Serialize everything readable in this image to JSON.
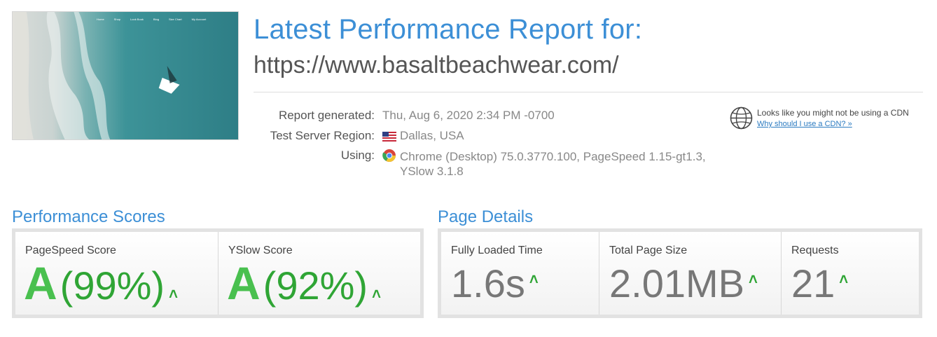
{
  "thumbnail": {
    "nav_items": [
      "Home",
      "Shop",
      "Look Book",
      "Blog",
      "Size Chart",
      "My Account"
    ]
  },
  "report": {
    "title": "Latest Performance Report for:",
    "url": "https://www.basaltbeachwear.com/"
  },
  "meta": {
    "generated_label": "Report generated:",
    "generated_value": "Thu, Aug 6, 2020 2:34 PM -0700",
    "region_label": "Test Server Region:",
    "region_value": "Dallas, USA",
    "using_label": "Using:",
    "using_value_line1": "Chrome (Desktop) 75.0.3770.100, PageSpeed 1.15-gt1.3,",
    "using_value_line2": "YSlow 3.1.8"
  },
  "cdn": {
    "text": "Looks like you might not be using a CDN",
    "link": "Why should I use a CDN? »"
  },
  "performance": {
    "title": "Performance Scores",
    "pagespeed": {
      "label": "PageSpeed Score",
      "grade": "A",
      "percent": "(99%)"
    },
    "yslow": {
      "label": "YSlow Score",
      "grade": "A",
      "percent": "(92%)"
    }
  },
  "details": {
    "title": "Page Details",
    "load_time": {
      "label": "Fully Loaded Time",
      "value": "1.6s"
    },
    "page_size": {
      "label": "Total Page Size",
      "value": "2.01MB"
    },
    "requests": {
      "label": "Requests",
      "value": "21"
    }
  },
  "colors": {
    "accent_blue": "#3c8fd6",
    "grade_green": "#49c04f",
    "arrow_green": "#2fa535"
  },
  "icons": {
    "up_arrow": "chevron-up-icon",
    "flag": "us-flag-icon",
    "browser": "chrome-icon",
    "cdn": "globe-icon"
  }
}
